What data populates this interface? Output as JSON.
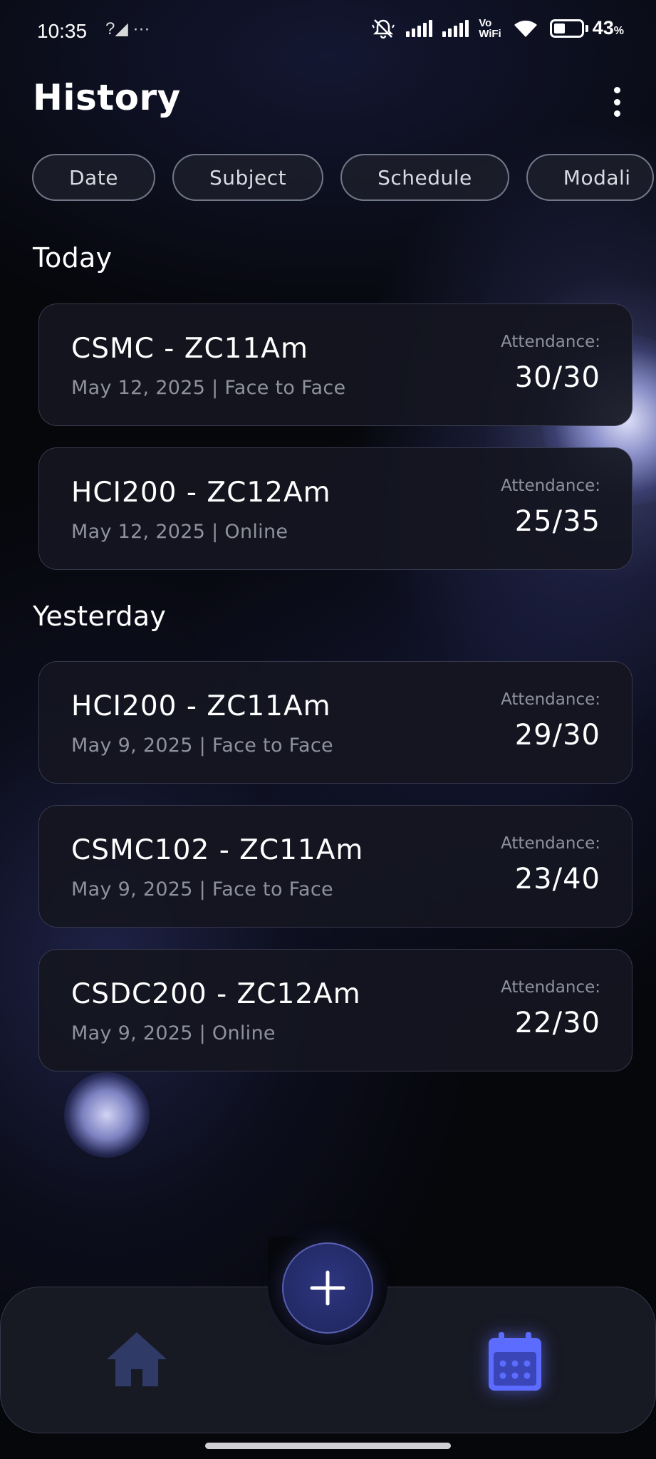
{
  "status_bar": {
    "time": "10:35",
    "left_icons": "?◢ ···",
    "battery_percent": "43",
    "battery_unit": "%",
    "vowifi_top": "Vo",
    "vowifi_bottom": "WiFi"
  },
  "header": {
    "title": "History"
  },
  "filters": [
    "Date",
    "Subject",
    "Schedule",
    "Modali"
  ],
  "sections": [
    {
      "title": "Today",
      "items": [
        {
          "title": "CSMC - ZC11Am",
          "subtitle": "May 12, 2025 | Face to Face",
          "attendance_label": "Attendance:",
          "attendance": "30/30"
        },
        {
          "title": "HCI200 - ZC12Am",
          "subtitle": "May 12, 2025 | Online",
          "attendance_label": "Attendance:",
          "attendance": "25/35"
        }
      ]
    },
    {
      "title": "Yesterday",
      "items": [
        {
          "title": "HCI200 - ZC11Am",
          "subtitle": "May 9, 2025 | Face to Face",
          "attendance_label": "Attendance:",
          "attendance": "29/30"
        },
        {
          "title": "CSMC102 - ZC11Am",
          "subtitle": "May 9, 2025 | Face to Face",
          "attendance_label": "Attendance:",
          "attendance": "23/40"
        },
        {
          "title": "CSDC200 - ZC12Am",
          "subtitle": "May 9, 2025 | Online",
          "attendance_label": "Attendance:",
          "attendance": "22/30"
        }
      ]
    }
  ],
  "bottom_nav": {
    "items": [
      {
        "icon": "home-icon",
        "active": false
      },
      {
        "icon": "calendar-icon",
        "active": true
      }
    ],
    "fab_icon": "plus-icon"
  },
  "colors": {
    "background": "#06070b",
    "card": "#14161f",
    "muted_text": "#8f929c",
    "accent": "#5b6cff",
    "inactive_icon": "#2f3a66"
  }
}
